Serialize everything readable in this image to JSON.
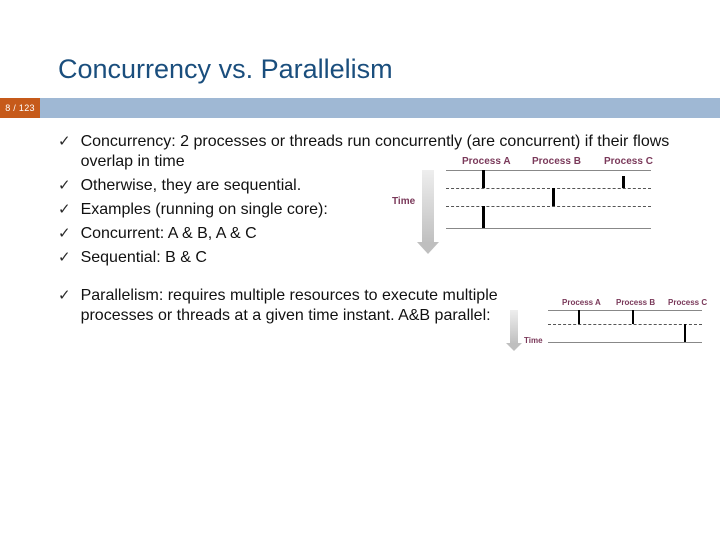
{
  "title": "Concurrency vs. Parallelism",
  "page": "8 / 123",
  "bullets": {
    "b1": "Concurrency: 2 processes or threads run concurrently (are concurrent) if their flows overlap in time",
    "b2": "Otherwise, they are sequential.",
    "b3": "Examples (running on single core):",
    "b4": "Concurrent: A & B, A & C",
    "b5": "Sequential: B & C",
    "b6": "Parallelism: requires multiple resources to execute multiple processes or threads at a given time instant. A&B parallel:"
  },
  "dia": {
    "time": "Time",
    "pA": "Process A",
    "pB": "Process B",
    "pC": "Process C"
  }
}
